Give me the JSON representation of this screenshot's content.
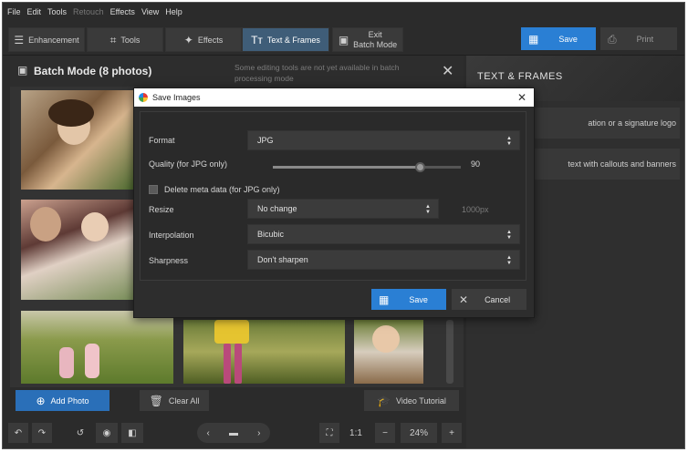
{
  "menu": [
    "File",
    "Edit",
    "Tools",
    "Retouch",
    "Effects",
    "View",
    "Help"
  ],
  "toolbar": {
    "enhancement": "Enhancement",
    "tools": "Tools",
    "effects": "Effects",
    "text_frames": "Text & Frames",
    "exit_batch_line1": "Exit",
    "exit_batch_line2": "Batch Mode",
    "save": "Save",
    "print": "Print"
  },
  "batch": {
    "title": "Batch Mode (8 photos)",
    "note": "Some editing tools are not yet available in batch processing mode",
    "add_photo": "Add Photo",
    "clear_all": "Clear All",
    "video_tutorial": "Video Tutorial"
  },
  "right_panel": {
    "title": "TEXT & FRAMES",
    "items": [
      "ation or a signature logo",
      "text with callouts and banners"
    ]
  },
  "bottom": {
    "zoom_1to1": "1:1",
    "zoom_percent": "24%"
  },
  "dialog": {
    "title": "Save Images",
    "format_label": "Format",
    "format_value": "JPG",
    "quality_label": "Quality (for JPG only)",
    "quality_value": "90",
    "quality_level": 0.78,
    "meta_label": "Delete meta data (for JPG only)",
    "resize_label": "Resize",
    "resize_value": "No change",
    "resize_px": "1000px",
    "interpolation_label": "Interpolation",
    "interpolation_value": "Bicubic",
    "sharpness_label": "Sharpness",
    "sharpness_value": "Don't sharpen",
    "save": "Save",
    "cancel": "Cancel"
  },
  "colors": {
    "accent": "#2a7fd4",
    "panel": "#2b2b2b"
  }
}
